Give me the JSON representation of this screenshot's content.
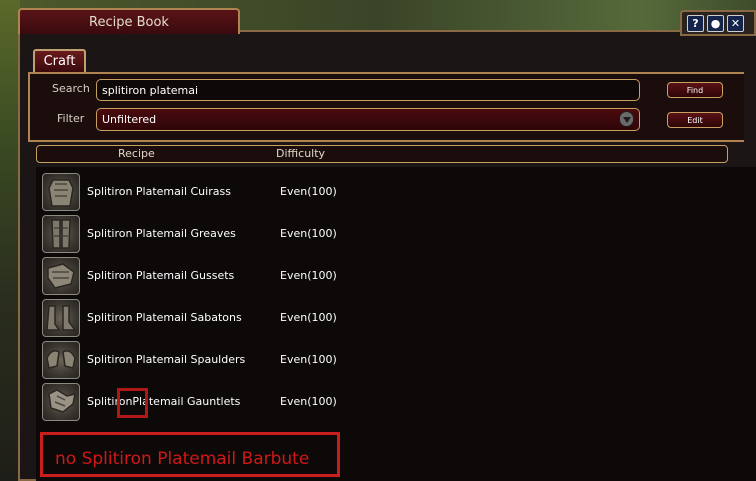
{
  "window": {
    "title": "Recipe Book"
  },
  "title_buttons": [
    "?",
    "●",
    "✕"
  ],
  "tabs": [
    {
      "label": "Craft"
    }
  ],
  "search": {
    "label": "Search",
    "value": "splitiron platemai",
    "button": "Find"
  },
  "filter": {
    "label": "Filter",
    "value": "Unfiltered",
    "button": "Edit"
  },
  "columns": {
    "recipe": "Recipe",
    "difficulty": "Difficulty"
  },
  "recipes": [
    {
      "name": "Splitiron Platemail Cuirass",
      "difficulty": "Even(100)",
      "icon": "cuirass-icon"
    },
    {
      "name": "Splitiron Platemail Greaves",
      "difficulty": "Even(100)",
      "icon": "greaves-icon"
    },
    {
      "name": "Splitiron Platemail Gussets",
      "difficulty": "Even(100)",
      "icon": "gussets-icon"
    },
    {
      "name": "Splitiron Platemail Sabatons",
      "difficulty": "Even(100)",
      "icon": "sabatons-icon"
    },
    {
      "name": "Splitiron Platemail Spaulders",
      "difficulty": "Even(100)",
      "icon": "spaulders-icon"
    },
    {
      "name": "SplitironPlatemail Gauntlets",
      "difficulty": "Even(100)",
      "icon": "gauntlets-icon"
    }
  ],
  "annotation": {
    "text": "no Splitiron Platemail Barbute",
    "color": "#c81e1e"
  }
}
